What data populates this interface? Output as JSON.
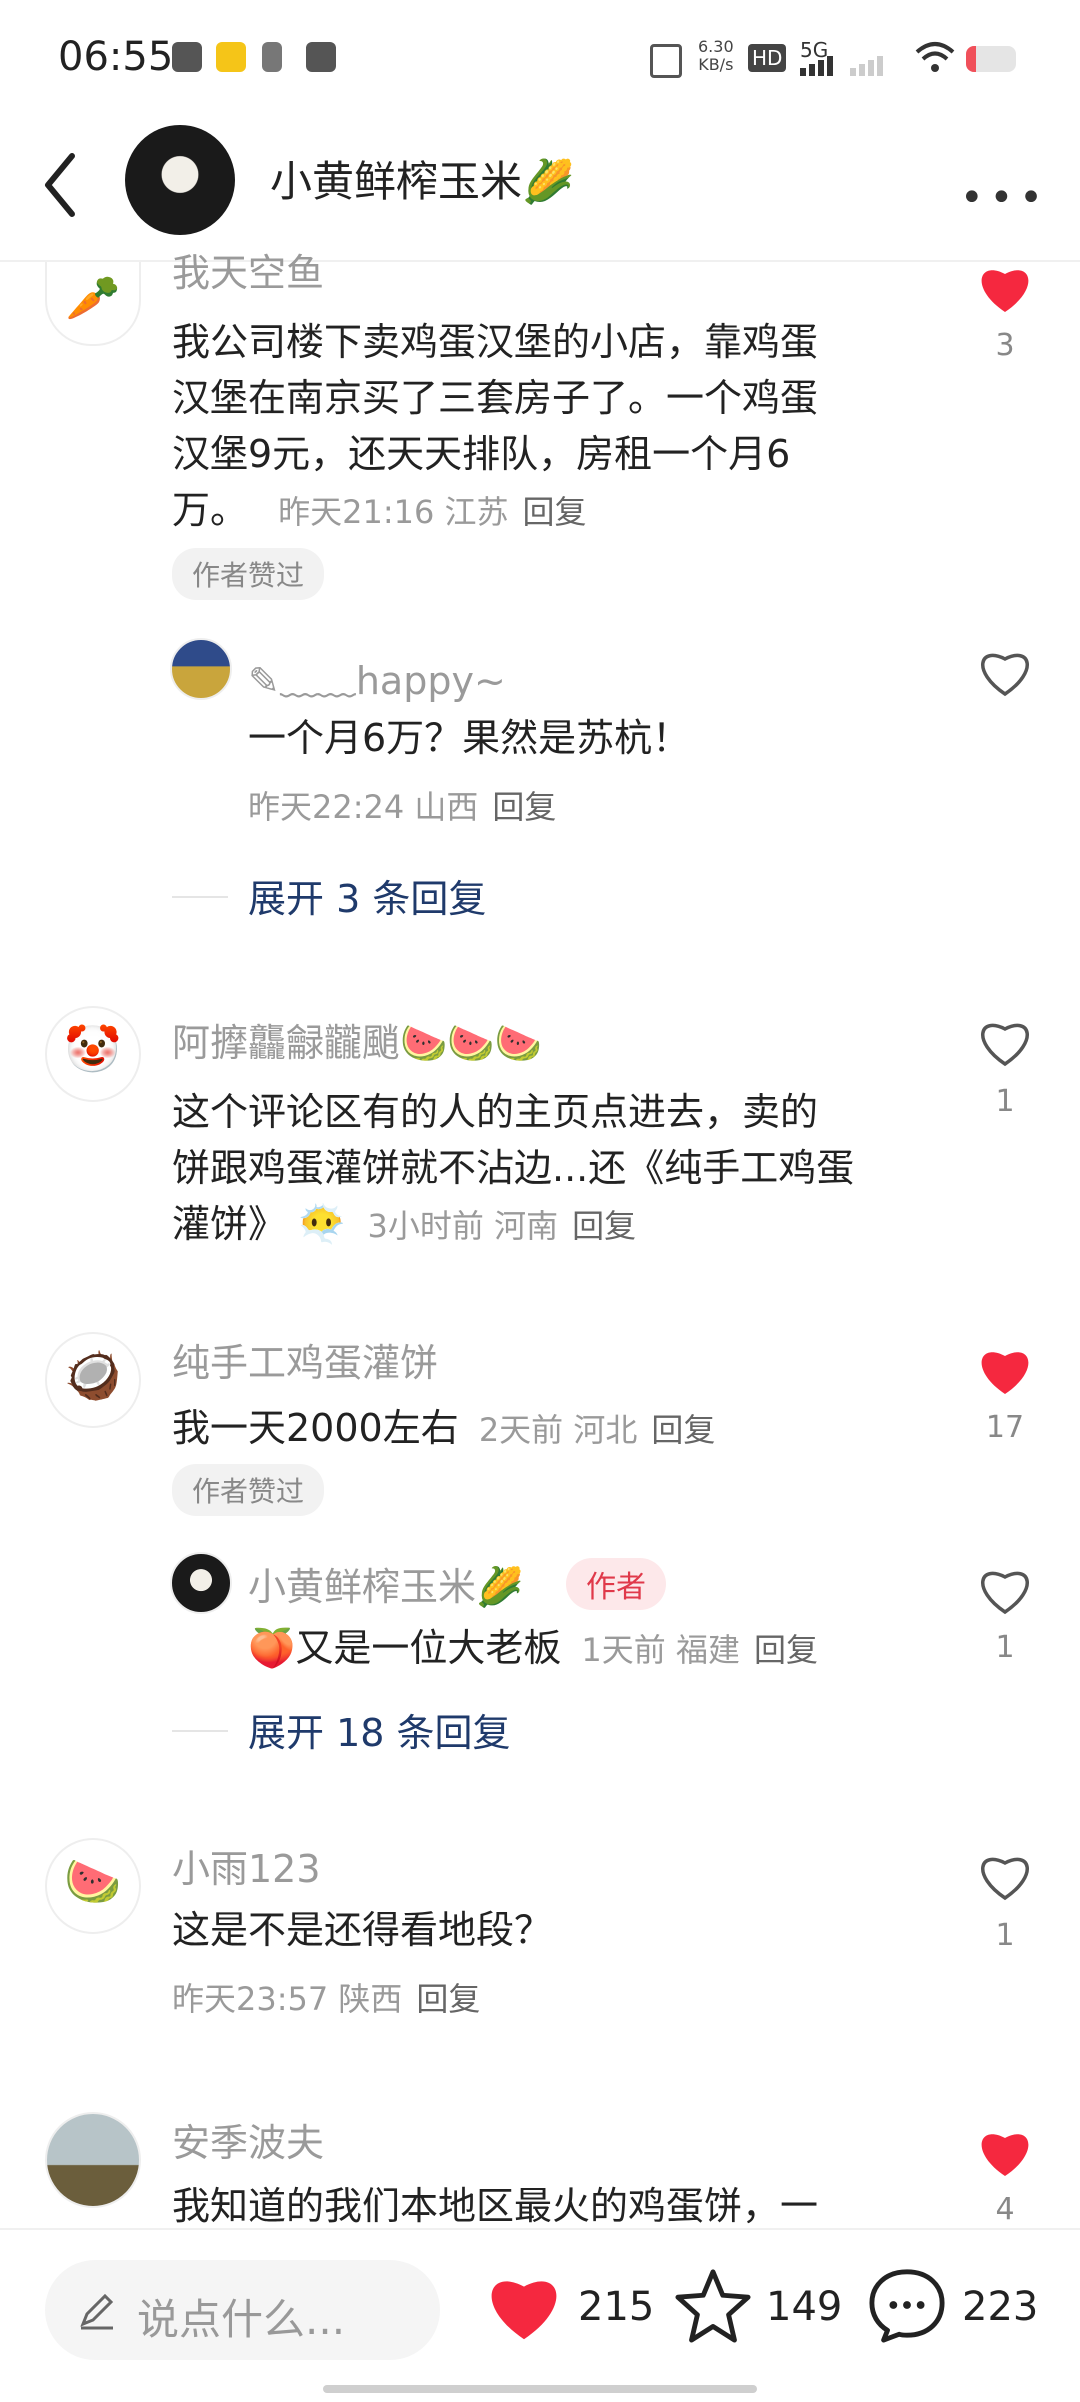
{
  "status_bar": {
    "time": "06:55",
    "net_speed_value": "6.30",
    "net_speed_unit": "KB/s",
    "hd": "HD",
    "signal": "5G"
  },
  "header": {
    "title": "小黄鲜榨玉米🌽"
  },
  "comments": [
    {
      "name": "我天空鱼",
      "text_lines": [
        "我公司楼下卖鸡蛋汉堡的小店，靠鸡蛋",
        "汉堡在南京买了三套房子了。一个鸡蛋",
        "汉堡9元，还天天排队，房租一个月6",
        "万。"
      ],
      "time": "昨天21:16 江苏",
      "reply": "回复",
      "badge": "作者赞过",
      "likes": "3",
      "replies": [
        {
          "name": "✎﹏﹏happy~",
          "text": "一个月6万？果然是苏杭！",
          "time": "昨天22:24 山西",
          "reply": "回复"
        }
      ],
      "expand": "展开 3 条回复"
    },
    {
      "name": "阿擵龘龣龖颵🍉🍉🍉",
      "text_lines": [
        "这个评论区有的人的主页点进去，卖的",
        "饼跟鸡蛋灌饼就不沾边...还《纯手工鸡蛋",
        "灌饼》"
      ],
      "emoji": "😶‍🌫️",
      "time": "3小时前 河南",
      "reply": "回复",
      "likes": "1"
    },
    {
      "name": "纯手工鸡蛋灌饼",
      "text_lines": [
        "我一天2000左右"
      ],
      "time": "2天前 河北",
      "reply": "回复",
      "badge": "作者赞过",
      "likes": "17",
      "replies": [
        {
          "name": "小黄鲜榨玉米🌽",
          "tag": "作者",
          "text": "🍑又是一位大老板",
          "time": "1天前 福建",
          "reply": "回复",
          "likes": "1"
        }
      ],
      "expand": "展开 18 条回复"
    },
    {
      "name": "小雨123",
      "text_lines": [
        "这是不是还得看地段？"
      ],
      "time": "昨天23:57 陕西",
      "reply": "回复",
      "likes": "1"
    },
    {
      "name": "安季波夫",
      "text_lines": [
        "我知道的我们本地区最火的鸡蛋饼，一"
      ],
      "likes": "4"
    }
  ],
  "bottom_bar": {
    "input_placeholder": "说点什么...",
    "likes": "215",
    "favorites": "149",
    "comments": "223"
  },
  "colors": {
    "like_red": "#f5283f",
    "link_blue": "#1f3a6b",
    "muted": "#9a9a9a"
  }
}
